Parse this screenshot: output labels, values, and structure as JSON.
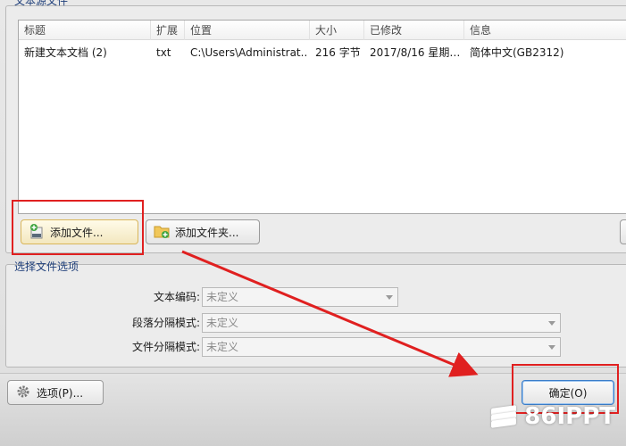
{
  "source_group": {
    "title": "文本源文件",
    "columns": [
      "标题",
      "扩展",
      "位置",
      "大小",
      "已修改",
      "信息"
    ],
    "rows": [
      {
        "title": "新建文本文档 (2)",
        "ext": "txt",
        "location": "C:\\Users\\Administrat..",
        "size": "216 字节",
        "modified": "2017/8/16 星期三..",
        "info": "简体中文(GB2312)"
      }
    ],
    "add_file_label": "添加文件...",
    "add_folder_label": "添加文件夹..."
  },
  "options_group": {
    "title": "选择文件选项",
    "encoding_label": "文本编码:",
    "encoding_value": "未定义",
    "paragraph_label": "段落分隔模式:",
    "paragraph_value": "未定义",
    "file_split_label": "文件分隔模式:",
    "file_split_value": "未定义"
  },
  "footer": {
    "options_label": "选项(P)...",
    "ok_label": "确定(O)"
  },
  "watermark": {
    "text": "86IPPT"
  },
  "colors": {
    "annotation": "#e02020",
    "group_title": "#1f3f7a"
  }
}
